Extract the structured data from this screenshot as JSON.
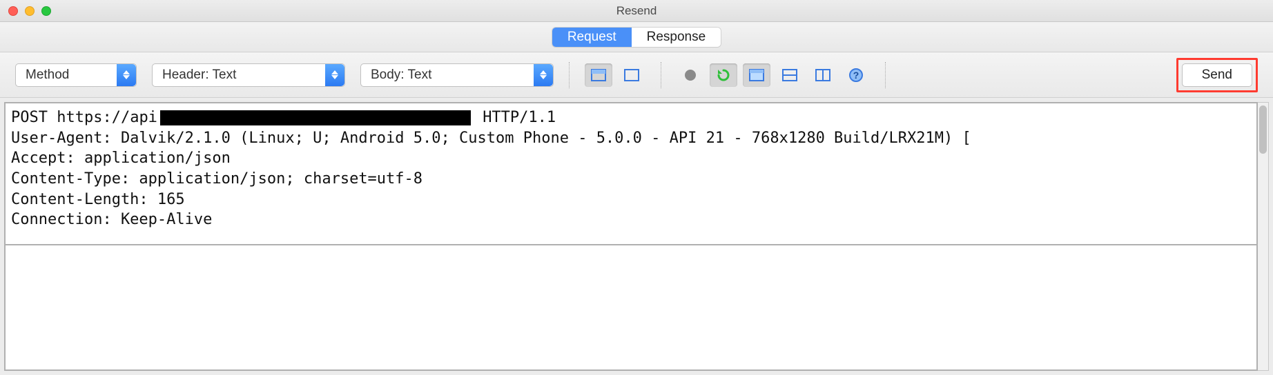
{
  "window": {
    "title": "Resend"
  },
  "tabs": {
    "request": "Request",
    "response": "Response",
    "active": "request"
  },
  "toolbar": {
    "method_select": "Method",
    "header_select": "Header: Text",
    "body_select": "Body: Text",
    "send_label": "Send"
  },
  "request": {
    "method": "POST",
    "url_prefix": "https://api",
    "url_redacted": true,
    "protocol": "HTTP/1.1",
    "headers": [
      "User-Agent: Dalvik/2.1.0 (Linux; U; Android 5.0; Custom Phone - 5.0.0 - API 21 - 768x1280 Build/LRX21M) [",
      "",
      "Accept: application/json",
      "Content-Type: application/json; charset=utf-8",
      "Content-Length: 165",
      "Connection: Keep-Alive"
    ]
  }
}
